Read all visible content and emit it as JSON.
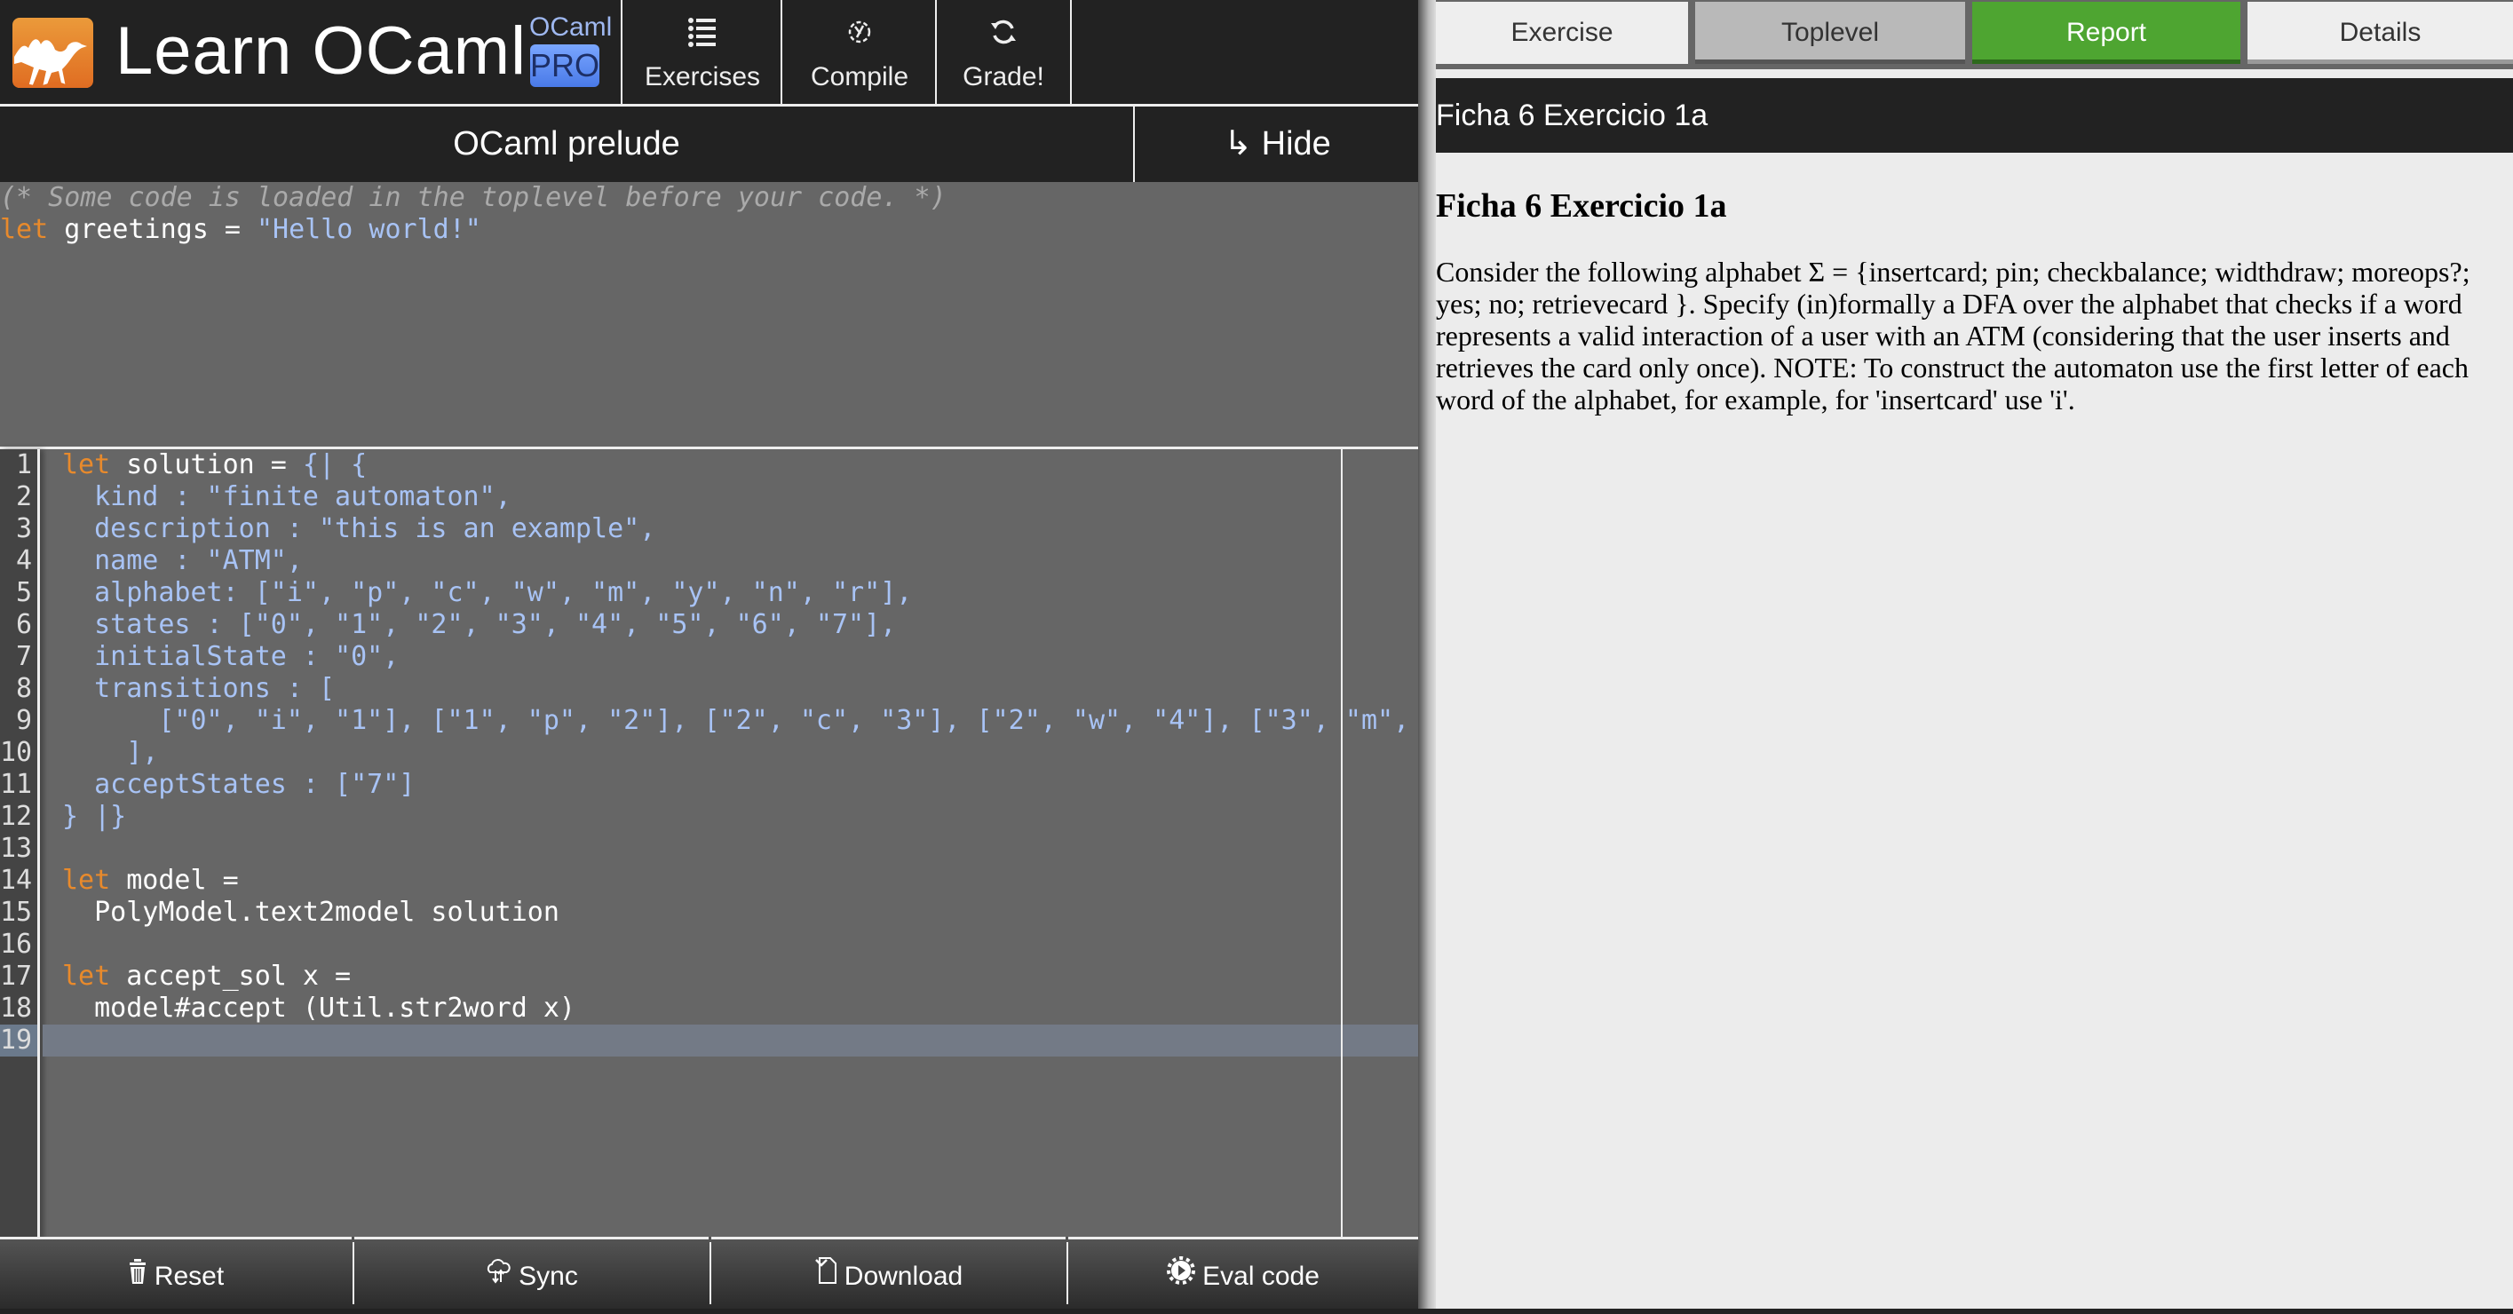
{
  "header": {
    "brand": "Learn OCaml",
    "ocaml_label": "OCaml",
    "pro_label": "PRO",
    "buttons": [
      {
        "label": "Exercises",
        "icon": "list-icon"
      },
      {
        "label": "Compile",
        "icon": "gear-wrench-icon"
      },
      {
        "label": "Grade!",
        "icon": "refresh-icon"
      }
    ]
  },
  "prelude": {
    "title": "OCaml prelude",
    "hide_label": "Hide",
    "hide_icon": "arrow-return-icon",
    "lines": [
      {
        "comment": "(* Some code is loaded in the toplevel before your code. *)"
      },
      {
        "kw": "let",
        "text": " greetings = ",
        "str": "\"Hello world!\""
      }
    ]
  },
  "editor": {
    "active_line": 19,
    "lines": [
      [
        {
          "t": "kw",
          "v": "let"
        },
        {
          "t": "tx",
          "v": " solution = "
        },
        {
          "t": "st",
          "v": "{| {"
        }
      ],
      [
        {
          "t": "st",
          "v": "  kind : \"finite automaton\","
        }
      ],
      [
        {
          "t": "st",
          "v": "  description : \"this is an example\","
        }
      ],
      [
        {
          "t": "st",
          "v": "  name : \"ATM\","
        }
      ],
      [
        {
          "t": "st",
          "v": "  alphabet: [\"i\", \"p\", \"c\", \"w\", \"m\", \"y\", \"n\", \"r\"],"
        }
      ],
      [
        {
          "t": "st",
          "v": "  states : [\"0\", \"1\", \"2\", \"3\", \"4\", \"5\", \"6\", \"7\"],"
        }
      ],
      [
        {
          "t": "st",
          "v": "  initialState : \"0\","
        }
      ],
      [
        {
          "t": "st",
          "v": "  transitions : ["
        }
      ],
      [
        {
          "t": "st",
          "v": "      [\"0\", \"i\", \"1\"], [\"1\", \"p\", \"2\"], [\"2\", \"c\", \"3\"], [\"2\", \"w\", \"4\"], [\"3\", \"m\","
        }
      ],
      [
        {
          "t": "st",
          "v": "    ],"
        }
      ],
      [
        {
          "t": "st",
          "v": "  acceptStates : [\"7\"]"
        }
      ],
      [
        {
          "t": "st",
          "v": "} |}"
        }
      ],
      [],
      [
        {
          "t": "kw",
          "v": "let"
        },
        {
          "t": "tx",
          "v": " model ="
        }
      ],
      [
        {
          "t": "tx",
          "v": "  PolyModel.text2model solution"
        }
      ],
      [],
      [
        {
          "t": "kw",
          "v": "let"
        },
        {
          "t": "tx",
          "v": " accept_sol x ="
        }
      ],
      [
        {
          "t": "tx",
          "v": "  model#accept (Util.str2word x)"
        }
      ],
      []
    ]
  },
  "toolbar": {
    "buttons": [
      {
        "label": "Reset",
        "icon": "trash-icon"
      },
      {
        "label": "Sync",
        "icon": "cloud-sync-icon"
      },
      {
        "label": "Download",
        "icon": "download-file-icon"
      },
      {
        "label": "Eval code",
        "icon": "eval-gear-icon"
      }
    ]
  },
  "right": {
    "tabs": [
      {
        "label": "Exercise",
        "state": "normal"
      },
      {
        "label": "Toplevel",
        "state": "inactive"
      },
      {
        "label": "Report",
        "state": "success"
      },
      {
        "label": "Details",
        "state": "normal"
      }
    ],
    "title": "Ficha 6 Exercicio 1a",
    "heading": "Ficha 6 Exercicio 1a",
    "description": "Consider the following alphabet Σ = {insertcard; pin; checkbalance; widthdraw; moreops?; yes; no; retrievecard }. Specify (in)formally a DFA over the alphabet that checks if a word represents a valid interaction of a user with an ATM (considering that the user inserts and retrieves the card only once). NOTE: To construct the automaton use the first letter of each word of the alphabet, for example, for 'insertcard' use 'i'.",
    "colors": {
      "report_tab": "#4ea531",
      "toplevel_tab": "#b9b9b9"
    }
  }
}
